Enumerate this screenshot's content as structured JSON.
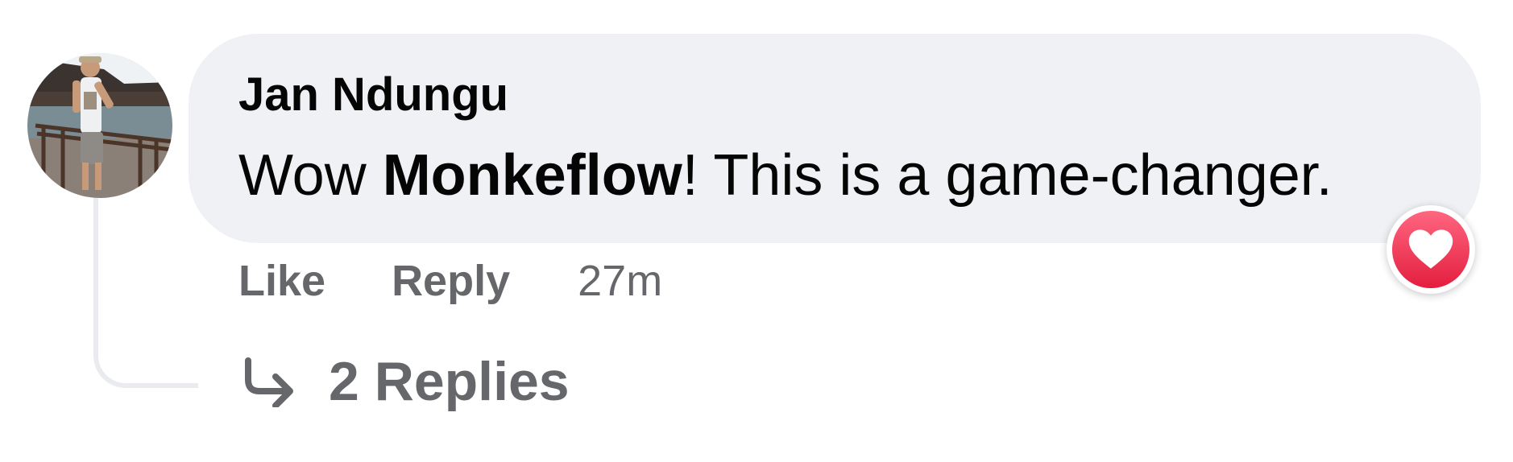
{
  "comment": {
    "author": "Jan Ndungu",
    "text_before": "Wow ",
    "mention": "Monkeflow",
    "text_after": "! This is a game-changer.",
    "reaction": "heart-icon",
    "reaction_color": "#e41e3f"
  },
  "actions": {
    "like_label": "Like",
    "reply_label": "Reply",
    "timestamp": "27m"
  },
  "replies": {
    "label": "2 Replies",
    "icon": "reply-arrow-icon"
  },
  "colors": {
    "bubble": "#f0f1f4",
    "secondary_text": "#65676b",
    "primary_text": "#050505"
  }
}
